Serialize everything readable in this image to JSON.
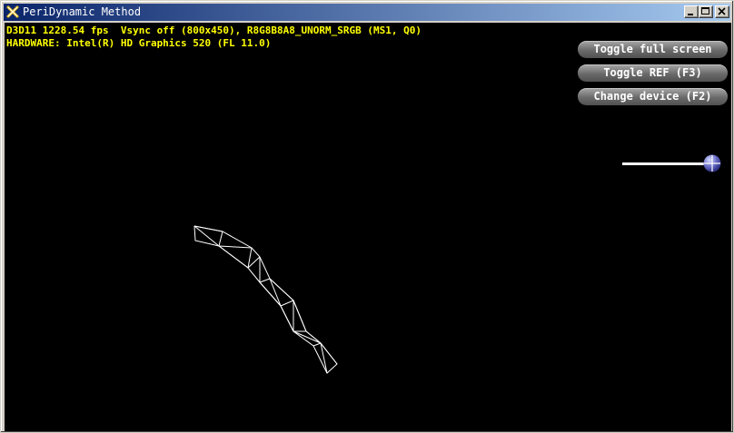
{
  "window": {
    "title": "PeriDynamic Method",
    "icon": "app-icon",
    "controls": [
      "minimize-icon",
      "maximize-icon",
      "close-icon"
    ]
  },
  "stats": {
    "line1": "D3D11 1228.54 fps  Vsync off (800x450), R8G8B8A8_UNORM_SRGB (MS1, Q0)",
    "line2": "HARDWARE: Intel(R) HD Graphics 520 (FL 11.0)"
  },
  "buttons": {
    "fullscreen": "Toggle full screen",
    "ref": "Toggle REF (F3)",
    "device": "Change device (F2)"
  },
  "slider": {
    "value_fraction": 0.95
  },
  "colors": {
    "stats_text": "#ffff00",
    "background": "#000000",
    "mesh": "#ffffff",
    "title_gradient_start": "#0a246a",
    "title_gradient_end": "#a6caf0"
  }
}
